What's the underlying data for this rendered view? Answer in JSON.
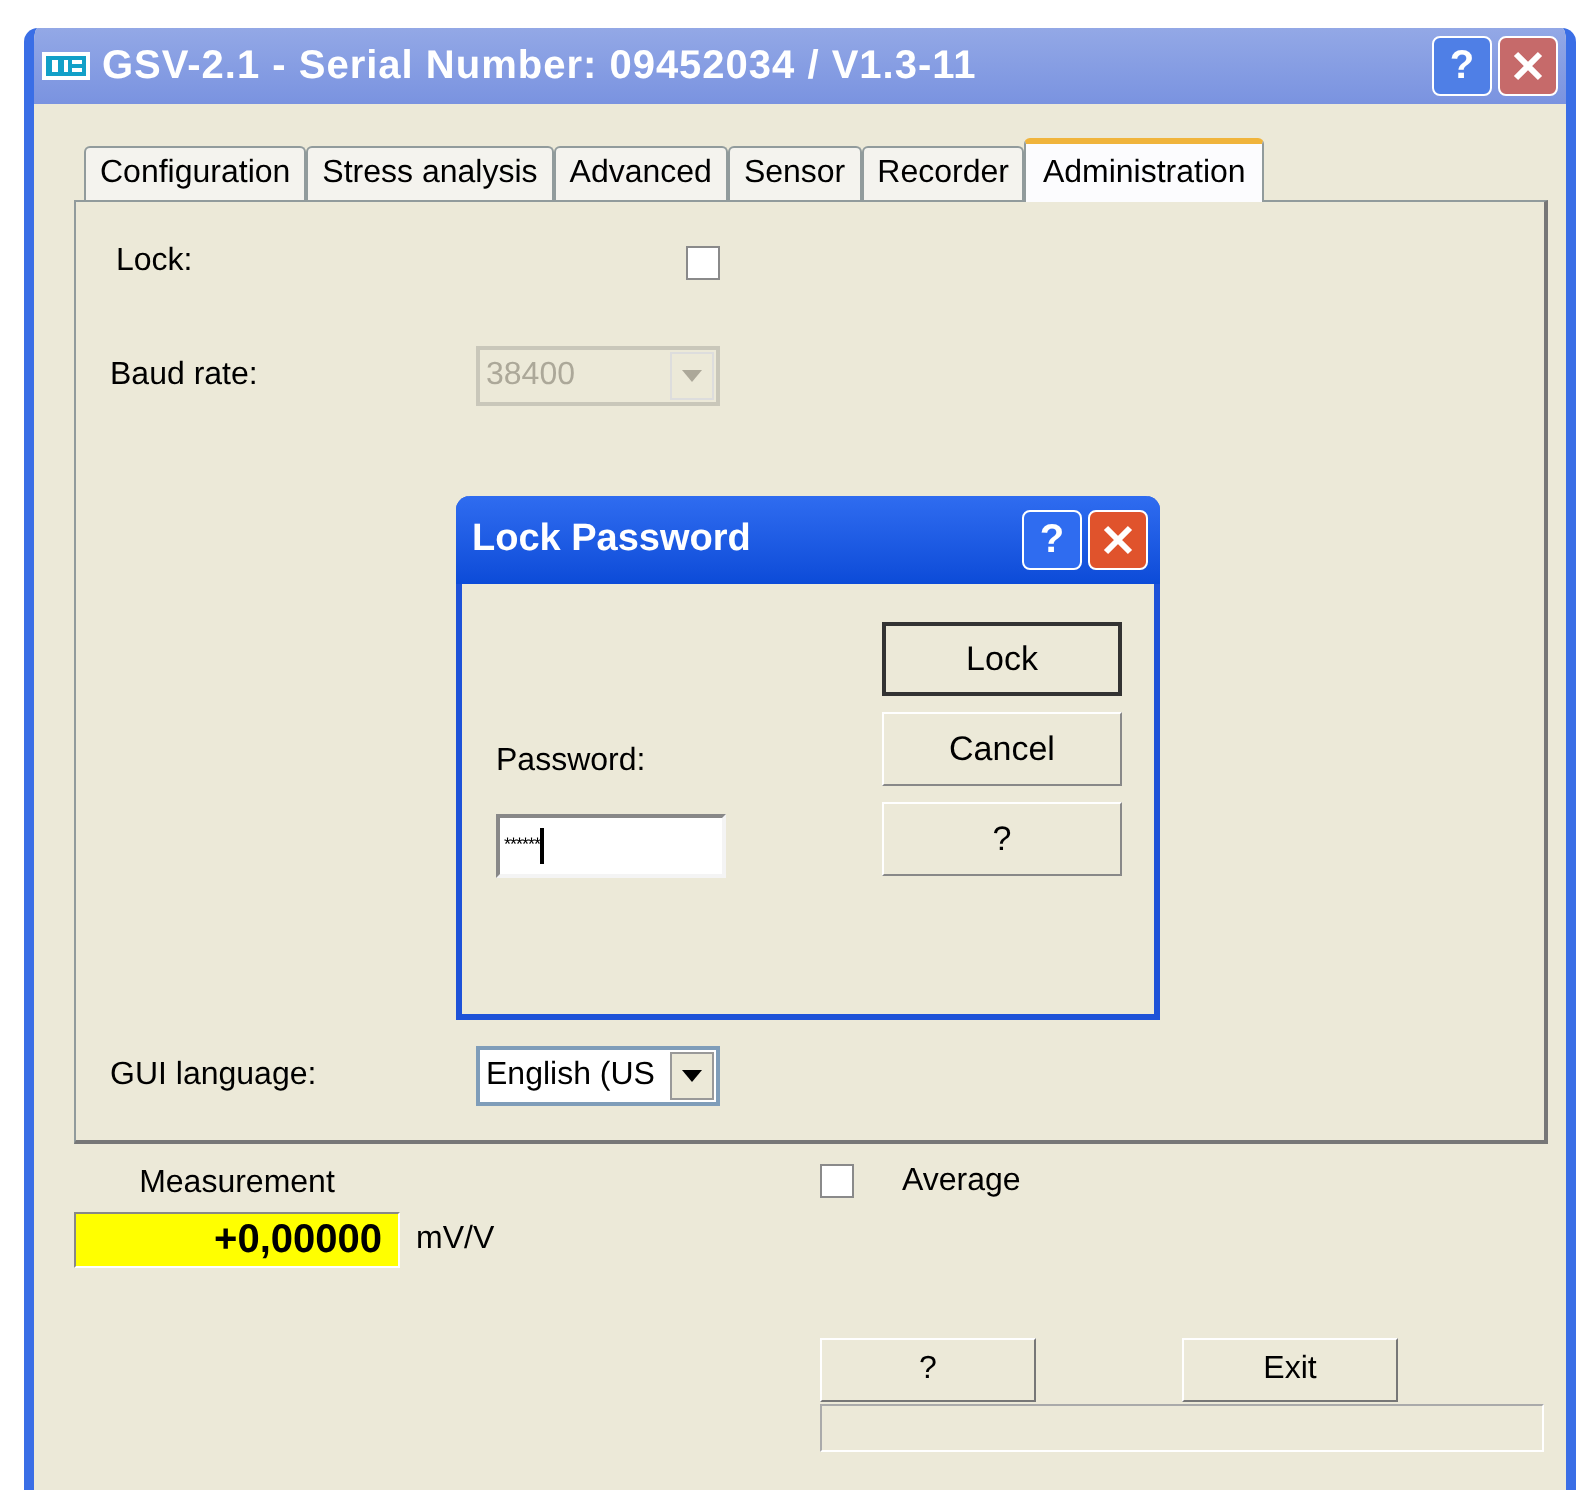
{
  "window": {
    "title": "GSV-2.1 - Serial Number: 09452034 / V1.3-11",
    "help_button": "?"
  },
  "tabs": [
    {
      "label": "Configuration",
      "selected": false
    },
    {
      "label": "Stress analysis",
      "selected": false
    },
    {
      "label": "Advanced",
      "selected": false
    },
    {
      "label": "Sensor",
      "selected": false
    },
    {
      "label": "Recorder",
      "selected": false
    },
    {
      "label": "Administration",
      "selected": true
    }
  ],
  "administration": {
    "lock": {
      "label": "Lock:",
      "checked": false
    },
    "baud_rate": {
      "label": "Baud rate:",
      "value": "38400",
      "disabled": true
    },
    "gui_language": {
      "label": "GUI language:",
      "value": "English (US",
      "disabled": false
    }
  },
  "measurement": {
    "label": "Measurement",
    "value": "+0,00000",
    "unit": "mV/V"
  },
  "average": {
    "label": "Average",
    "checked": false
  },
  "buttons": [
    {
      "label": "?"
    },
    {
      "label": "Exit"
    }
  ],
  "dialog": {
    "title": "Lock Password",
    "help_button": "?",
    "password": {
      "label": "Password:",
      "value": "******"
    },
    "buttons": [
      {
        "label": "Lock",
        "default": true
      },
      {
        "label": "Cancel",
        "default": false
      },
      {
        "label": "?",
        "default": false
      }
    ]
  }
}
